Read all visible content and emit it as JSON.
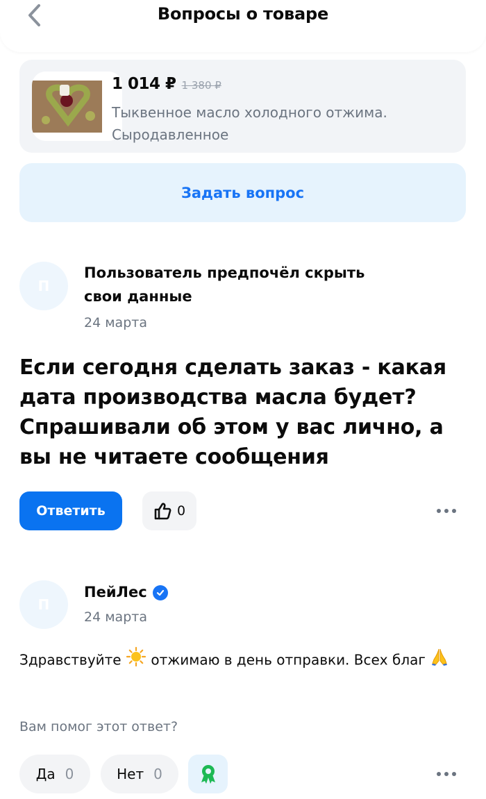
{
  "header": {
    "title": "Вопросы о товаре",
    "back_icon": "chevron-left-icon"
  },
  "product": {
    "price": "1 014 ₽",
    "old_price": "1 380 ₽",
    "name": "Тыквенное масло холодного отжима. Сыродавленное",
    "image": "pumpkin-oil-product-image"
  },
  "ask_button": {
    "label": "Задать вопрос"
  },
  "question": {
    "author": "Пользователь предпочёл скрыть свои данные",
    "avatar_letter": "П",
    "date": "24 марта",
    "text": "Если сегодня сделать заказ - какая дата производства масла будет? Спрашивали об этом у вас лично, а вы не читаете сообщения",
    "reply_label": "Ответить",
    "likes": "0"
  },
  "answer": {
    "author": "ПейЛес",
    "avatar_letter": "П",
    "verified": true,
    "date": "24 марта",
    "text_part1": "Здравствуйте",
    "text_part2": "отжимаю в день отправки. Всех благ",
    "helpful_question": "Вам помог этот ответ?",
    "yes_label": "Да",
    "yes_count": "0",
    "no_label": "Нет",
    "no_count": "0"
  },
  "colors": {
    "accent": "#0a73f0",
    "accent_light": "#e6f3fd",
    "card_bg": "#f2f4f7",
    "muted_text": "#6b7480",
    "award_green": "#1db954"
  }
}
